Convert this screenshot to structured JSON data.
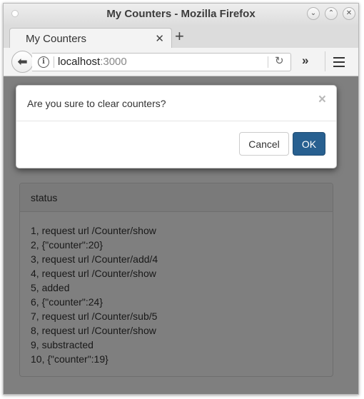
{
  "window": {
    "title": "My Counters - Mozilla Firefox",
    "controls": {
      "minimize": "⌄",
      "maximize": "⌃",
      "close": "✕"
    }
  },
  "tabs": [
    {
      "title": "My Counters",
      "close": "✕"
    }
  ],
  "new_tab": "+",
  "navbar": {
    "back": "⬅",
    "url_host": "localhost",
    "url_port": ":3000",
    "reload": "↻",
    "overflow": "»"
  },
  "panel": {
    "heading": "status",
    "lines": [
      "1, request url /Counter/show",
      "2, {\"counter\":20}",
      "3, request url /Counter/add/4",
      "4, request url /Counter/show",
      "5, added",
      "6, {\"counter\":24}",
      "7, request url /Counter/sub/5",
      "8, request url /Counter/show",
      "9, substracted",
      "10, {\"counter\":19}"
    ]
  },
  "modal": {
    "message": "Are you sure to clear counters?",
    "close": "×",
    "cancel_label": "Cancel",
    "ok_label": "OK"
  },
  "colors": {
    "ok_button": "#286090",
    "backdrop": "rgba(0,0,0,0.5)"
  }
}
